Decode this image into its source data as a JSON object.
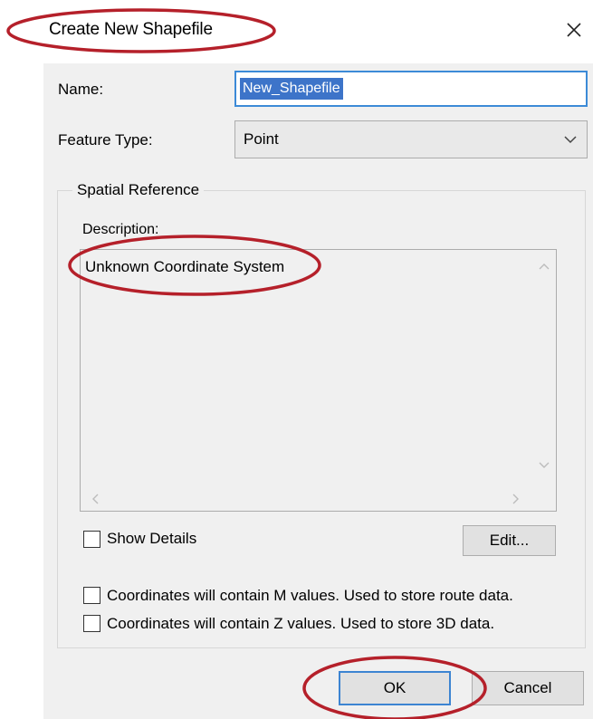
{
  "window": {
    "title": "Create New Shapefile",
    "close_icon": "close-icon"
  },
  "form": {
    "name_label": "Name:",
    "name_value": "New_Shapefile",
    "feature_type_label": "Feature Type:",
    "feature_type_value": "Point"
  },
  "spatial_reference": {
    "group_title": "Spatial Reference",
    "description_label": "Description:",
    "description_text": "Unknown Coordinate System",
    "show_details_label": "Show Details",
    "show_details_checked": false,
    "edit_label": "Edit..."
  },
  "options": {
    "m_values_label": "Coordinates will contain M values. Used to store route data.",
    "m_values_checked": false,
    "z_values_label": "Coordinates will contain Z values. Used to store 3D data.",
    "z_values_checked": false
  },
  "buttons": {
    "ok_label": "OK",
    "cancel_label": "Cancel"
  },
  "colors": {
    "annotation_ellipse": "#b5202a",
    "selection": "#3d74c9",
    "focus_border": "#3c8ad7",
    "dialog_background": "#f0f0f0"
  }
}
